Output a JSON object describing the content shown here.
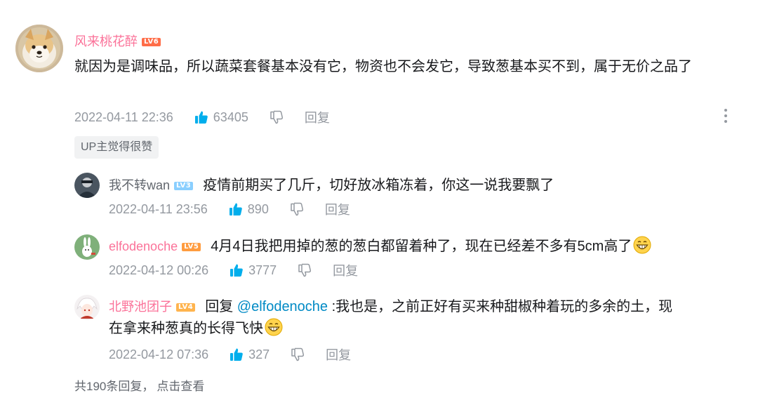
{
  "main_comment": {
    "username": "风来桃花醉",
    "level": "LV6",
    "text": "就因为是调味品，所以蔬菜套餐基本没有它，物资也不会发它，导致葱基本买不到，属于无价之品了",
    "time": "2022-04-11 22:36",
    "likes": "63405",
    "reply_label": "回复",
    "up_badge": "UP主觉得很赞"
  },
  "replies": [
    {
      "username": "我不转wan",
      "level": "LV3",
      "text": "疫情前期买了几斤，切好放冰箱冻着，你这一说我要飘了",
      "time": "2022-04-11 23:56",
      "likes": "890",
      "reply_label": "回复"
    },
    {
      "username": "elfodenoche",
      "level": "LV5",
      "text": "4月4日我把用掉的葱的葱白都留着种了，现在已经差不多有5cm高了",
      "time": "2022-04-12 00:26",
      "likes": "3777",
      "reply_label": "回复",
      "emoji": "grin-emoji"
    },
    {
      "username": "北野池团子",
      "level": "LV4",
      "reply_prefix": "回复",
      "mention": "@elfodenoche",
      "text_line1": ":我也是，之前正好有买来种甜椒种着玩的多余的土，现",
      "text_line2": "在拿来种葱真的长得飞快",
      "time": "2022-04-12 07:36",
      "likes": "327",
      "reply_label": "回复",
      "emoji": "grin-emoji"
    }
  ],
  "footer": {
    "summary": "共190条回复，",
    "view_link": "点击查看"
  },
  "colors": {
    "vip_pink": "#fb7299",
    "like_blue": "#00aeec",
    "meta_gray": "#9499a0",
    "link_blue": "#008ac5"
  }
}
